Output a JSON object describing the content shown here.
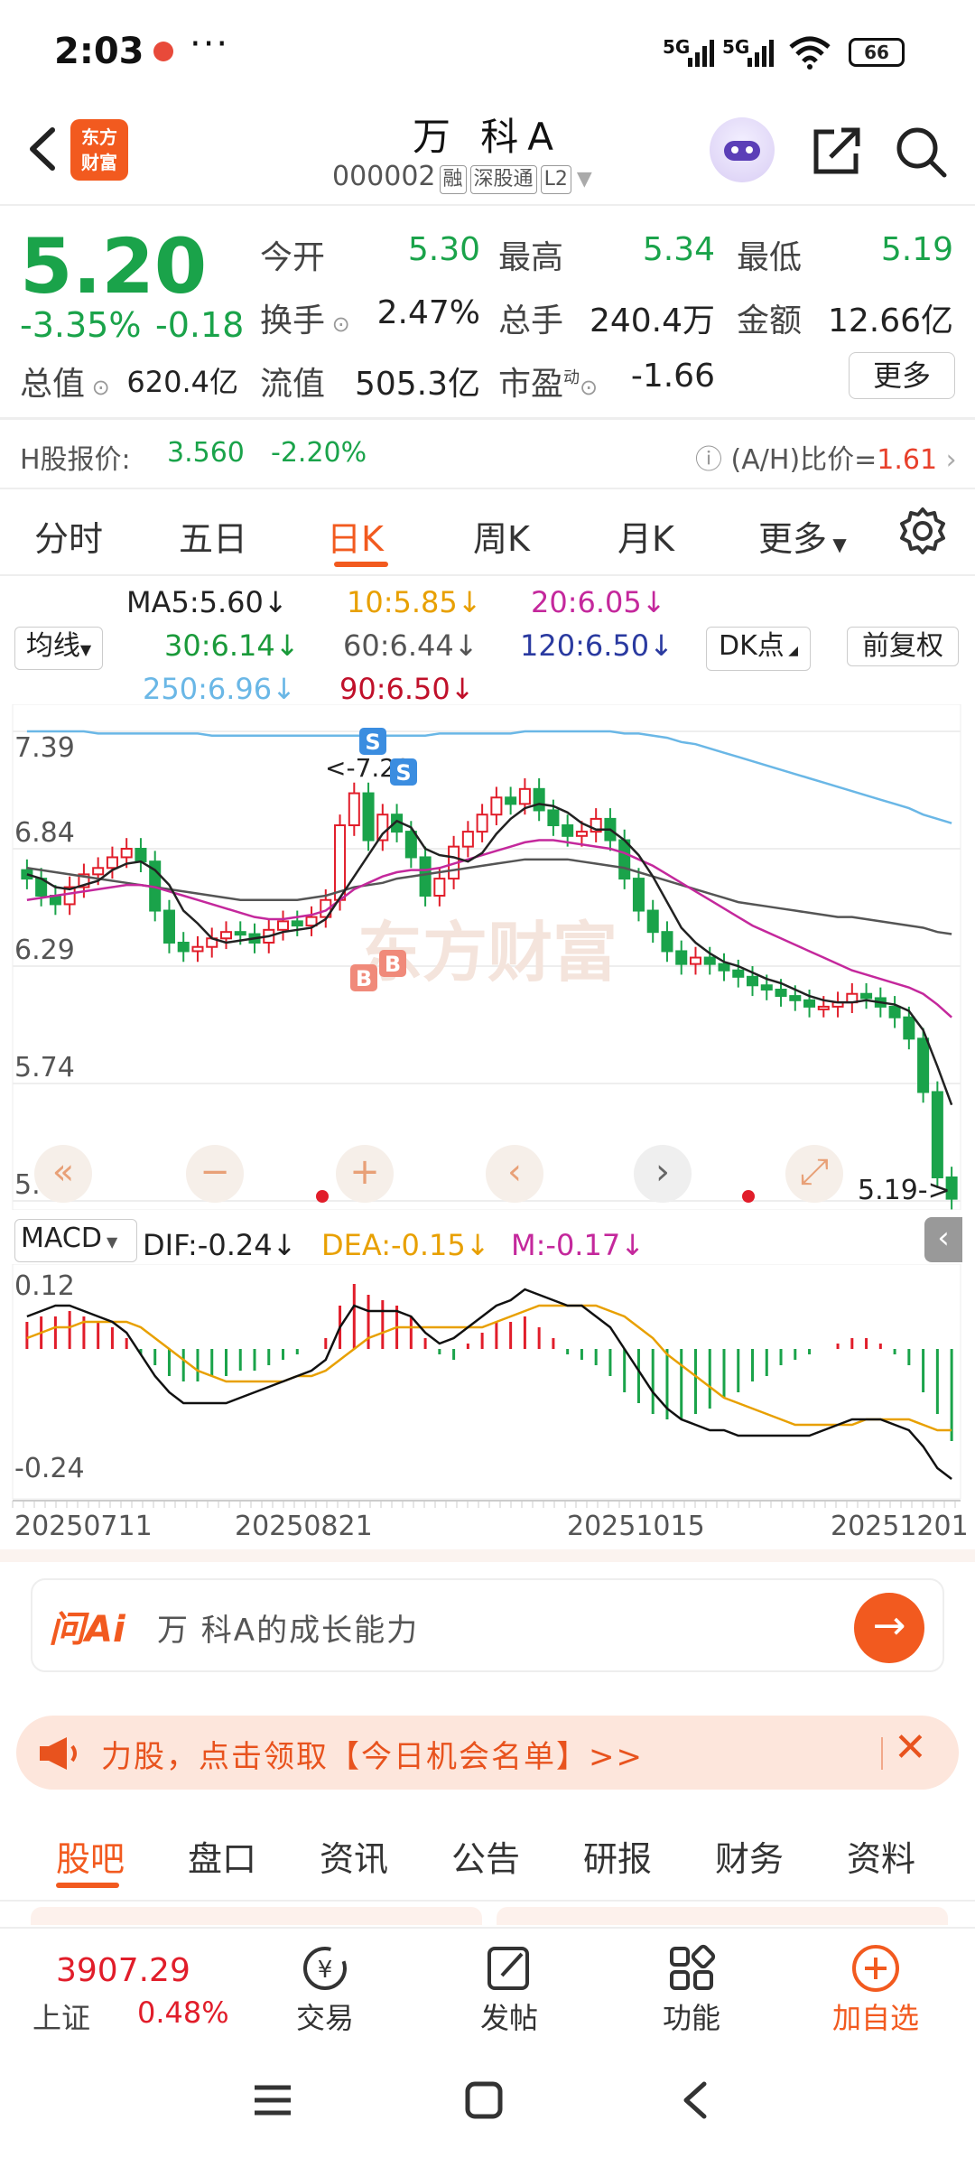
{
  "status_bar": {
    "time": "2:03",
    "more": "···",
    "signal1": "5G",
    "signal2": "5G",
    "battery": "66"
  },
  "header": {
    "logo_line1": "东方",
    "logo_line2": "财富",
    "name": "万 科A",
    "code": "000002",
    "tags": [
      "融",
      "深股通",
      "L2"
    ]
  },
  "quote": {
    "price": "5.20",
    "change_pct": "-3.35%",
    "change_amt": "-0.18",
    "open_label": "今开",
    "open": "5.30",
    "high_label": "最高",
    "high": "5.34",
    "low_label": "最低",
    "low": "5.19",
    "turnover_label": "换手",
    "turnover": "2.47%",
    "volume_label": "总手",
    "volume": "240.4万",
    "amount_label": "金额",
    "amount": "12.66亿",
    "mktcap_label": "总值",
    "mktcap": "620.4亿",
    "float_label": "流值",
    "float_cap": "505.3亿",
    "pe_label": "市盈",
    "pe_sup": "动",
    "pe": "-1.66",
    "more": "更多"
  },
  "h_share": {
    "label": "H股报价:",
    "price": "3.560",
    "change": "-2.20%",
    "ratio_label": "(A/H)比价=",
    "ratio": "1.61"
  },
  "period_tabs": [
    "分时",
    "五日",
    "日K",
    "周K",
    "月K",
    "更多"
  ],
  "active_period": 2,
  "ma_legend": {
    "ma_select": "均线",
    "ma5": "MA5:5.60",
    "ma10": "10:5.85",
    "ma20": "20:6.05",
    "ma30": "30:6.14",
    "ma60": "60:6.44",
    "ma120": "120:6.50",
    "ma250": "250:6.96",
    "ma90": "90:6.50",
    "dk": "DK点",
    "adjust": "前复权",
    "arrow": "↓"
  },
  "chart_data": {
    "type": "candlestick",
    "y_ticks": [
      "7.39",
      "6.84",
      "6.29",
      "5.74",
      "5.19"
    ],
    "ylim": [
      5.19,
      7.39
    ],
    "x_ticks": [
      "20250711",
      "20250821",
      "20251015",
      "20251201"
    ],
    "high_marker": "<-7.22",
    "low_marker": "5.19->",
    "signals": [
      "S",
      "S",
      "B",
      "B"
    ],
    "watermark": "东方财富",
    "closes": [
      6.7,
      6.62,
      6.58,
      6.66,
      6.72,
      6.75,
      6.8,
      6.84,
      6.78,
      6.55,
      6.4,
      6.36,
      6.38,
      6.42,
      6.45,
      6.44,
      6.4,
      6.46,
      6.5,
      6.48,
      6.52,
      6.6,
      6.95,
      7.1,
      6.88,
      7.0,
      6.92,
      6.8,
      6.62,
      6.7,
      6.85,
      6.92,
      7.0,
      7.08,
      7.05,
      7.12,
      7.02,
      6.95,
      6.9,
      6.92,
      6.98,
      6.88,
      6.7,
      6.55,
      6.45,
      6.36,
      6.3,
      6.33,
      6.3,
      6.27,
      6.24,
      6.2,
      6.18,
      6.15,
      6.13,
      6.1,
      6.1,
      6.12,
      6.16,
      6.14,
      6.1,
      6.05,
      5.95,
      5.7,
      5.3,
      5.2
    ],
    "ma5": [
      6.72,
      6.7,
      6.66,
      6.65,
      6.67,
      6.69,
      6.74,
      6.77,
      6.78,
      6.74,
      6.67,
      6.55,
      6.49,
      6.42,
      6.4,
      6.41,
      6.42,
      6.43,
      6.45,
      6.46,
      6.47,
      6.51,
      6.61,
      6.71,
      6.81,
      6.91,
      6.97,
      6.94,
      6.84,
      6.81,
      6.8,
      6.78,
      6.82,
      6.91,
      6.98,
      7.03,
      7.05,
      7.04,
      7.01,
      6.96,
      6.93,
      6.93,
      6.88,
      6.81,
      6.71,
      6.59,
      6.47,
      6.4,
      6.35,
      6.31,
      6.29,
      6.26,
      6.23,
      6.21,
      6.18,
      6.15,
      6.13,
      6.12,
      6.12,
      6.13,
      6.12,
      6.11,
      6.08,
      5.99,
      5.82,
      5.64
    ],
    "ma20": [
      6.6,
      6.61,
      6.62,
      6.63,
      6.64,
      6.65,
      6.66,
      6.67,
      6.67,
      6.66,
      6.64,
      6.62,
      6.6,
      6.58,
      6.56,
      6.54,
      6.52,
      6.51,
      6.51,
      6.52,
      6.53,
      6.55,
      6.6,
      6.65,
      6.68,
      6.71,
      6.73,
      6.74,
      6.74,
      6.75,
      6.77,
      6.79,
      6.81,
      6.83,
      6.85,
      6.87,
      6.88,
      6.88,
      6.87,
      6.86,
      6.85,
      6.84,
      6.82,
      6.79,
      6.76,
      6.72,
      6.68,
      6.64,
      6.6,
      6.56,
      6.52,
      6.48,
      6.45,
      6.42,
      6.39,
      6.36,
      6.33,
      6.3,
      6.27,
      6.25,
      6.23,
      6.21,
      6.19,
      6.16,
      6.11,
      6.05
    ],
    "ma60": [
      6.75,
      6.74,
      6.73,
      6.72,
      6.71,
      6.7,
      6.69,
      6.68,
      6.67,
      6.66,
      6.65,
      6.64,
      6.63,
      6.62,
      6.61,
      6.6,
      6.6,
      6.6,
      6.6,
      6.6,
      6.61,
      6.62,
      6.64,
      6.66,
      6.67,
      6.68,
      6.7,
      6.71,
      6.72,
      6.73,
      6.74,
      6.75,
      6.76,
      6.77,
      6.78,
      6.79,
      6.79,
      6.79,
      6.79,
      6.78,
      6.77,
      6.76,
      6.75,
      6.73,
      6.71,
      6.69,
      6.67,
      6.65,
      6.63,
      6.61,
      6.59,
      6.58,
      6.57,
      6.56,
      6.55,
      6.54,
      6.53,
      6.52,
      6.52,
      6.51,
      6.5,
      6.49,
      6.48,
      6.47,
      6.45,
      6.44
    ],
    "ma250": [
      7.39,
      7.39,
      7.39,
      7.39,
      7.39,
      7.38,
      7.38,
      7.38,
      7.38,
      7.38,
      7.38,
      7.38,
      7.38,
      7.37,
      7.37,
      7.37,
      7.37,
      7.37,
      7.37,
      7.37,
      7.37,
      7.37,
      7.37,
      7.37,
      7.37,
      7.37,
      7.37,
      7.37,
      7.37,
      7.38,
      7.38,
      7.38,
      7.38,
      7.38,
      7.38,
      7.39,
      7.39,
      7.39,
      7.39,
      7.39,
      7.39,
      7.39,
      7.38,
      7.38,
      7.37,
      7.36,
      7.34,
      7.33,
      7.31,
      7.29,
      7.27,
      7.25,
      7.23,
      7.21,
      7.19,
      7.17,
      7.15,
      7.13,
      7.11,
      7.09,
      7.07,
      7.05,
      7.03,
      7.0,
      6.98,
      6.96
    ]
  },
  "controls": [
    "«",
    "−",
    "+",
    "‹",
    "›",
    "⤢"
  ],
  "macd": {
    "select": "MACD",
    "dif": "DIF:-0.24",
    "dea": "DEA:-0.15",
    "m": "M:-0.17",
    "arrow": "↓",
    "y_top": "0.12",
    "y_bottom": "-0.24",
    "hist": [
      0.05,
      0.06,
      0.06,
      0.07,
      0.06,
      0.05,
      0.04,
      0.02,
      -0.01,
      -0.03,
      -0.05,
      -0.06,
      -0.06,
      -0.05,
      -0.05,
      -0.04,
      -0.04,
      -0.03,
      -0.02,
      -0.01,
      0.0,
      0.02,
      0.08,
      0.12,
      0.1,
      0.09,
      0.08,
      0.06,
      0.02,
      -0.01,
      -0.02,
      0.01,
      0.03,
      0.05,
      0.05,
      0.06,
      0.04,
      0.02,
      -0.01,
      -0.02,
      -0.03,
      -0.05,
      -0.08,
      -0.1,
      -0.12,
      -0.13,
      -0.13,
      -0.12,
      -0.11,
      -0.09,
      -0.08,
      -0.06,
      -0.05,
      -0.03,
      -0.02,
      -0.01,
      0.0,
      0.01,
      0.02,
      0.02,
      0.01,
      -0.01,
      -0.03,
      -0.08,
      -0.12,
      -0.17
    ],
    "dif_line": [
      0.06,
      0.07,
      0.08,
      0.08,
      0.07,
      0.06,
      0.05,
      0.03,
      -0.01,
      -0.05,
      -0.08,
      -0.1,
      -0.1,
      -0.1,
      -0.1,
      -0.09,
      -0.08,
      -0.07,
      -0.06,
      -0.05,
      -0.04,
      -0.02,
      0.04,
      0.08,
      0.07,
      0.07,
      0.07,
      0.06,
      0.03,
      0.01,
      0.02,
      0.04,
      0.06,
      0.08,
      0.09,
      0.11,
      0.1,
      0.09,
      0.08,
      0.08,
      0.06,
      0.04,
      0.0,
      -0.04,
      -0.08,
      -0.11,
      -0.13,
      -0.14,
      -0.15,
      -0.15,
      -0.16,
      -0.16,
      -0.16,
      -0.16,
      -0.16,
      -0.16,
      -0.15,
      -0.14,
      -0.13,
      -0.13,
      -0.13,
      -0.14,
      -0.15,
      -0.18,
      -0.22,
      -0.24
    ],
    "dea_line": [
      0.02,
      0.03,
      0.04,
      0.04,
      0.05,
      0.05,
      0.05,
      0.05,
      0.04,
      0.02,
      0.0,
      -0.02,
      -0.04,
      -0.05,
      -0.06,
      -0.06,
      -0.06,
      -0.06,
      -0.06,
      -0.05,
      -0.05,
      -0.04,
      -0.02,
      0.0,
      0.02,
      0.03,
      0.04,
      0.04,
      0.04,
      0.04,
      0.04,
      0.04,
      0.04,
      0.05,
      0.06,
      0.07,
      0.08,
      0.08,
      0.08,
      0.08,
      0.08,
      0.07,
      0.06,
      0.04,
      0.02,
      -0.01,
      -0.03,
      -0.05,
      -0.07,
      -0.09,
      -0.1,
      -0.11,
      -0.12,
      -0.13,
      -0.14,
      -0.14,
      -0.14,
      -0.14,
      -0.14,
      -0.13,
      -0.13,
      -0.13,
      -0.13,
      -0.14,
      -0.15,
      -0.15
    ]
  },
  "ask_ai": {
    "logo": "问Ai",
    "text": "万 科A的成长能力"
  },
  "banner": {
    "text": "力股，点击领取【今日机会名单】>>"
  },
  "bottom_tabs": [
    "股吧",
    "盘口",
    "资讯",
    "公告",
    "研报",
    "财务",
    "资料"
  ],
  "nav": {
    "index_value": "3907.29",
    "index_name": "上证",
    "index_change": "0.48%",
    "items": [
      "交易",
      "发帖",
      "功能",
      "加自选"
    ]
  },
  "colors": {
    "up": "#e11d2a",
    "down": "#1aa34a",
    "brand": "#f25a1f"
  }
}
